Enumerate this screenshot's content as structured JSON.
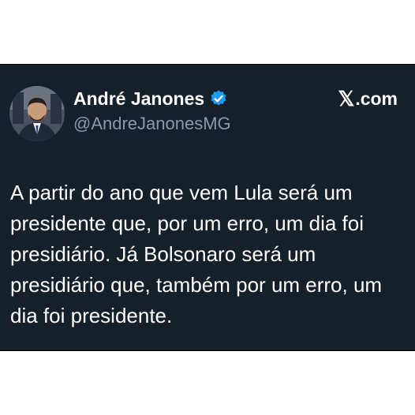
{
  "author": {
    "display_name": "André Janones",
    "handle": "@AndreJanonesMG",
    "verified": true,
    "avatar_icon": "profile-photo"
  },
  "brand": {
    "logo_icon": "x-logo-icon",
    "logo_glyph": "𝕏",
    "label": ".com"
  },
  "tweet": {
    "text": "A partir do ano que vem Lula será um presidente que, por um erro, um dia foi presidiário. Já Bolsonaro será um presidiário que, também por um erro, um dia foi presidente."
  },
  "colors": {
    "card_background": "#16202b",
    "page_background": "#ffffff",
    "text_primary": "#ffffff",
    "text_secondary": "#8b98a5",
    "verified_badge": "#1d9bf0"
  }
}
